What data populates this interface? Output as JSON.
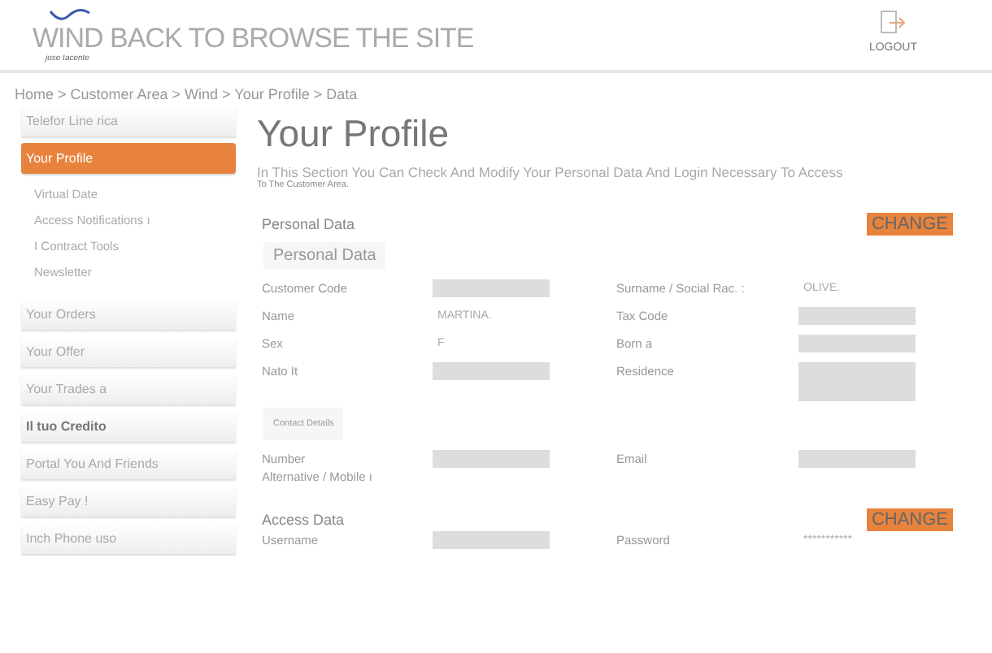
{
  "header": {
    "site_link": "WIND BACK TO BROWSE THE SITE",
    "tagline": "jose tacente",
    "logout": "LOGOUT"
  },
  "breadcrumb": "Home > Customer Area > Wind > Your Profile > Data",
  "sidebar": {
    "items": [
      {
        "label": "Telefor Line rica",
        "selected": false
      },
      {
        "label": "Your Profile",
        "selected": true,
        "children": [
          {
            "label": "Virtual Date"
          },
          {
            "label": "Access Notifications ı"
          },
          {
            "label": "I Contract Tools"
          },
          {
            "label": "Newsletter"
          }
        ]
      },
      {
        "label": "Your Orders",
        "selected": false
      },
      {
        "label": "Your Offer",
        "selected": false
      },
      {
        "label": "Your Trades a",
        "selected": false
      },
      {
        "label": "Il tuo Credito",
        "selected": false
      },
      {
        "label": "Portal You And Friends",
        "selected": false
      },
      {
        "label": "Easy Pay !",
        "selected": false
      },
      {
        "label": "Inch Phone uso",
        "selected": false
      }
    ]
  },
  "main": {
    "title": "Your Profile",
    "intro": "In This Section You Can Check And Modify Your Personal Data And Login Necessary To Access",
    "intro_2": "To The Customer Area.",
    "personal": {
      "heading": "Personal Data",
      "change": "CHANGE",
      "tab": "Personal Data",
      "fields": [
        {
          "label": "Customer Code",
          "kind": "redacted"
        },
        {
          "label": "Surname / Social Rac. :",
          "kind": "text",
          "value": "OLIVE."
        },
        {
          "label": "Name",
          "kind": "text",
          "value": "MARTINA."
        },
        {
          "label": "Tax Code",
          "kind": "redacted"
        },
        {
          "label": "Sex",
          "kind": "text",
          "value": "F"
        },
        {
          "label": "Born a",
          "kind": "redacted"
        },
        {
          "label": "Nato It",
          "kind": "redacted"
        },
        {
          "label": "Residence",
          "kind": "redacted_tall"
        }
      ]
    },
    "contact": {
      "tab": "Contact Details",
      "fields": [
        {
          "label": "Number",
          "label_2": "Alternative / Mobile ı",
          "kind": "redacted"
        },
        {
          "label": "Email",
          "kind": "redacted"
        }
      ]
    },
    "access": {
      "heading": "Access Data",
      "change": "CHANGE",
      "fields": [
        {
          "label": "Username",
          "kind": "redacted"
        },
        {
          "label": "Password",
          "kind": "text",
          "value": "***********"
        }
      ]
    }
  }
}
